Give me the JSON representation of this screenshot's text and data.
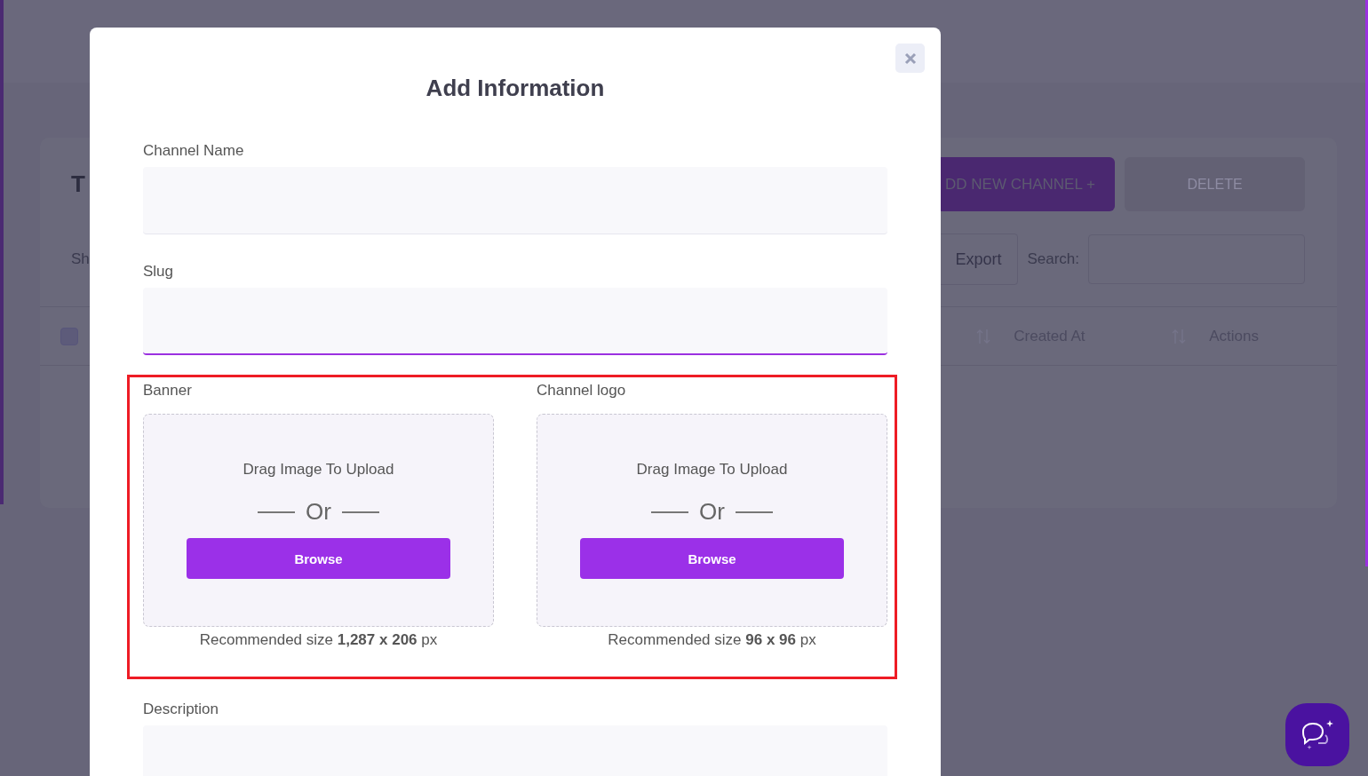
{
  "background": {
    "title": "T",
    "show_label": "Sh",
    "add_button": "DD NEW CHANNEL +",
    "delete_button": "DELETE",
    "export_button": "Export",
    "search_label": "Search:",
    "table": {
      "select_all_checked": false,
      "columns": [
        "Created At",
        "Actions"
      ]
    }
  },
  "modal": {
    "title": "Add Information",
    "fields": [
      {
        "label": "Channel Name",
        "focused": false
      },
      {
        "label": "Slug",
        "focused": true
      }
    ],
    "uploads": [
      {
        "label": "Banner",
        "drag_text": "Drag Image To Upload",
        "or_text": "Or",
        "button": "Browse",
        "hint": "Recommended size **1,287 x 206** px"
      },
      {
        "label": "Channel logo",
        "drag_text": "Drag Image To Upload",
        "or_text": "Or",
        "button": "Browse",
        "hint": "Recommended size **96 x 96** px"
      }
    ],
    "description_label": "Description"
  }
}
